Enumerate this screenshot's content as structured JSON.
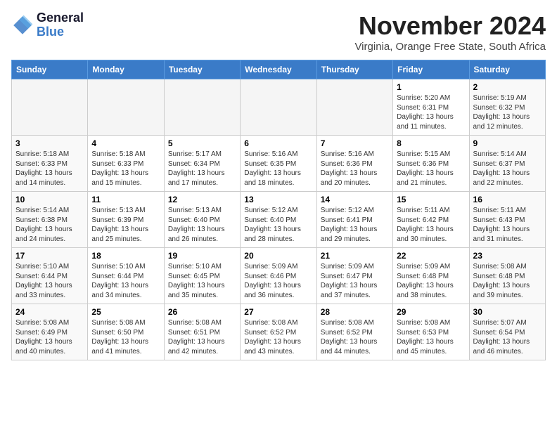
{
  "logo": {
    "line1": "General",
    "line2": "Blue"
  },
  "title": "November 2024",
  "location": "Virginia, Orange Free State, South Africa",
  "header": {
    "days": [
      "Sunday",
      "Monday",
      "Tuesday",
      "Wednesday",
      "Thursday",
      "Friday",
      "Saturday"
    ]
  },
  "weeks": [
    {
      "cells": [
        {
          "day": "",
          "info": ""
        },
        {
          "day": "",
          "info": ""
        },
        {
          "day": "",
          "info": ""
        },
        {
          "day": "",
          "info": ""
        },
        {
          "day": "",
          "info": ""
        },
        {
          "day": "1",
          "info": "Sunrise: 5:20 AM\nSunset: 6:31 PM\nDaylight: 13 hours\nand 11 minutes."
        },
        {
          "day": "2",
          "info": "Sunrise: 5:19 AM\nSunset: 6:32 PM\nDaylight: 13 hours\nand 12 minutes."
        }
      ]
    },
    {
      "cells": [
        {
          "day": "3",
          "info": "Sunrise: 5:18 AM\nSunset: 6:33 PM\nDaylight: 13 hours\nand 14 minutes."
        },
        {
          "day": "4",
          "info": "Sunrise: 5:18 AM\nSunset: 6:33 PM\nDaylight: 13 hours\nand 15 minutes."
        },
        {
          "day": "5",
          "info": "Sunrise: 5:17 AM\nSunset: 6:34 PM\nDaylight: 13 hours\nand 17 minutes."
        },
        {
          "day": "6",
          "info": "Sunrise: 5:16 AM\nSunset: 6:35 PM\nDaylight: 13 hours\nand 18 minutes."
        },
        {
          "day": "7",
          "info": "Sunrise: 5:16 AM\nSunset: 6:36 PM\nDaylight: 13 hours\nand 20 minutes."
        },
        {
          "day": "8",
          "info": "Sunrise: 5:15 AM\nSunset: 6:36 PM\nDaylight: 13 hours\nand 21 minutes."
        },
        {
          "day": "9",
          "info": "Sunrise: 5:14 AM\nSunset: 6:37 PM\nDaylight: 13 hours\nand 22 minutes."
        }
      ]
    },
    {
      "cells": [
        {
          "day": "10",
          "info": "Sunrise: 5:14 AM\nSunset: 6:38 PM\nDaylight: 13 hours\nand 24 minutes."
        },
        {
          "day": "11",
          "info": "Sunrise: 5:13 AM\nSunset: 6:39 PM\nDaylight: 13 hours\nand 25 minutes."
        },
        {
          "day": "12",
          "info": "Sunrise: 5:13 AM\nSunset: 6:40 PM\nDaylight: 13 hours\nand 26 minutes."
        },
        {
          "day": "13",
          "info": "Sunrise: 5:12 AM\nSunset: 6:40 PM\nDaylight: 13 hours\nand 28 minutes."
        },
        {
          "day": "14",
          "info": "Sunrise: 5:12 AM\nSunset: 6:41 PM\nDaylight: 13 hours\nand 29 minutes."
        },
        {
          "day": "15",
          "info": "Sunrise: 5:11 AM\nSunset: 6:42 PM\nDaylight: 13 hours\nand 30 minutes."
        },
        {
          "day": "16",
          "info": "Sunrise: 5:11 AM\nSunset: 6:43 PM\nDaylight: 13 hours\nand 31 minutes."
        }
      ]
    },
    {
      "cells": [
        {
          "day": "17",
          "info": "Sunrise: 5:10 AM\nSunset: 6:44 PM\nDaylight: 13 hours\nand 33 minutes."
        },
        {
          "day": "18",
          "info": "Sunrise: 5:10 AM\nSunset: 6:44 PM\nDaylight: 13 hours\nand 34 minutes."
        },
        {
          "day": "19",
          "info": "Sunrise: 5:10 AM\nSunset: 6:45 PM\nDaylight: 13 hours\nand 35 minutes."
        },
        {
          "day": "20",
          "info": "Sunrise: 5:09 AM\nSunset: 6:46 PM\nDaylight: 13 hours\nand 36 minutes."
        },
        {
          "day": "21",
          "info": "Sunrise: 5:09 AM\nSunset: 6:47 PM\nDaylight: 13 hours\nand 37 minutes."
        },
        {
          "day": "22",
          "info": "Sunrise: 5:09 AM\nSunset: 6:48 PM\nDaylight: 13 hours\nand 38 minutes."
        },
        {
          "day": "23",
          "info": "Sunrise: 5:08 AM\nSunset: 6:48 PM\nDaylight: 13 hours\nand 39 minutes."
        }
      ]
    },
    {
      "cells": [
        {
          "day": "24",
          "info": "Sunrise: 5:08 AM\nSunset: 6:49 PM\nDaylight: 13 hours\nand 40 minutes."
        },
        {
          "day": "25",
          "info": "Sunrise: 5:08 AM\nSunset: 6:50 PM\nDaylight: 13 hours\nand 41 minutes."
        },
        {
          "day": "26",
          "info": "Sunrise: 5:08 AM\nSunset: 6:51 PM\nDaylight: 13 hours\nand 42 minutes."
        },
        {
          "day": "27",
          "info": "Sunrise: 5:08 AM\nSunset: 6:52 PM\nDaylight: 13 hours\nand 43 minutes."
        },
        {
          "day": "28",
          "info": "Sunrise: 5:08 AM\nSunset: 6:52 PM\nDaylight: 13 hours\nand 44 minutes."
        },
        {
          "day": "29",
          "info": "Sunrise: 5:08 AM\nSunset: 6:53 PM\nDaylight: 13 hours\nand 45 minutes."
        },
        {
          "day": "30",
          "info": "Sunrise: 5:07 AM\nSunset: 6:54 PM\nDaylight: 13 hours\nand 46 minutes."
        }
      ]
    }
  ]
}
